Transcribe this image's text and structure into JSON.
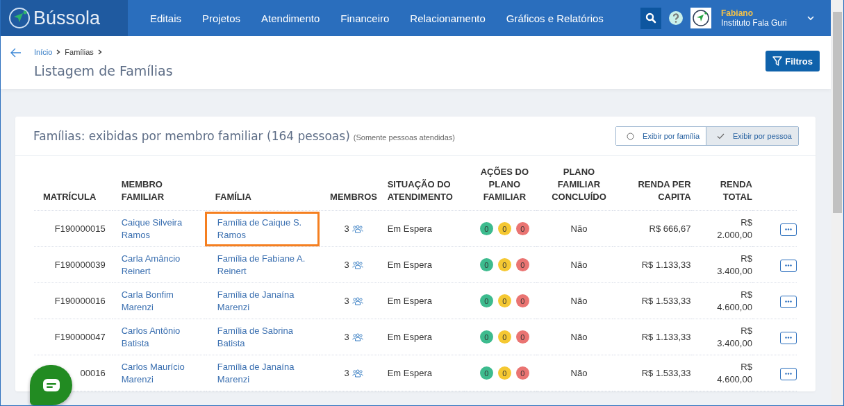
{
  "brand": {
    "name": "Bússola"
  },
  "nav": [
    "Editais",
    "Projetos",
    "Atendimento",
    "Financeiro",
    "Relacionamento",
    "Gráficos e Relatórios"
  ],
  "user": {
    "name": "Fabiano",
    "org": "Instituto Fala Guri"
  },
  "breadcrumb": [
    {
      "label": "Início",
      "link": true
    },
    {
      "label": "Famílias",
      "link": false
    }
  ],
  "page_title": "Listagem de Famílias",
  "filters_button": "Filtros",
  "card": {
    "title": "Famílias: exibidas por membro familiar (164 pessoas)",
    "note": "(Somente pessoas atendidas)",
    "view_options": [
      {
        "label": "Exibir por família",
        "selected": false
      },
      {
        "label": "Exibir por pessoa",
        "selected": true
      }
    ]
  },
  "table": {
    "columns": [
      "MATRÍCULA",
      "MEMBRO FAMILIAR",
      "FAMÍLIA",
      "MEMBROS",
      "SITUAÇÃO DO ATENDIMENTO",
      "AÇÕES DO PLANO FAMILIAR",
      "PLANO FAMILIAR CONCLUÍDO",
      "RENDA PER CAPITA",
      "RENDA TOTAL"
    ],
    "rows": [
      {
        "matricula": "F190000015",
        "membro": "Caique Silveira Ramos",
        "familia": "Família de Caique S. Ramos",
        "highlighted": true,
        "membros": "3",
        "situacao": "Em Espera",
        "acoes": [
          {
            "count": "0",
            "color": "#3dbb8e"
          },
          {
            "count": "0",
            "color": "#f5c832"
          },
          {
            "count": "0",
            "color": "#ea7472"
          }
        ],
        "concluido": "Não",
        "renda_per_capita": "R$ 666,67",
        "renda_total": "R$ 2.000,00"
      },
      {
        "matricula": "F190000039",
        "membro": "Carla Amâncio Reinert",
        "familia": "Família de Fabiane A. Reinert",
        "highlighted": false,
        "membros": "3",
        "situacao": "Em Espera",
        "acoes": [
          {
            "count": "0",
            "color": "#3dbb8e"
          },
          {
            "count": "0",
            "color": "#f5c832"
          },
          {
            "count": "0",
            "color": "#ea7472"
          }
        ],
        "concluido": "Não",
        "renda_per_capita": "R$ 1.133,33",
        "renda_total": "R$ 3.400,00"
      },
      {
        "matricula": "F190000016",
        "membro": "Carla Bonfim Marenzi",
        "familia": "Família de Janaína Marenzi",
        "highlighted": false,
        "membros": "3",
        "situacao": "Em Espera",
        "acoes": [
          {
            "count": "0",
            "color": "#3dbb8e"
          },
          {
            "count": "0",
            "color": "#f5c832"
          },
          {
            "count": "0",
            "color": "#ea7472"
          }
        ],
        "concluido": "Não",
        "renda_per_capita": "R$ 1.533,33",
        "renda_total": "R$ 4.600,00"
      },
      {
        "matricula": "F190000047",
        "membro": "Carlos Antônio Batista",
        "familia": "Família de Sabrina Batista",
        "highlighted": false,
        "membros": "3",
        "situacao": "Em Espera",
        "acoes": [
          {
            "count": "0",
            "color": "#3dbb8e"
          },
          {
            "count": "0",
            "color": "#f5c832"
          },
          {
            "count": "0",
            "color": "#ea7472"
          }
        ],
        "concluido": "Não",
        "renda_per_capita": "R$ 1.133,33",
        "renda_total": "R$ 3.400,00"
      },
      {
        "matricula": "00016",
        "membro": "Carlos Maurício Marenzi",
        "familia": "Família de Janaína Marenzi",
        "highlighted": false,
        "membros": "3",
        "situacao": "Em Espera",
        "acoes": [
          {
            "count": "0",
            "color": "#3dbb8e"
          },
          {
            "count": "0",
            "color": "#f5c832"
          },
          {
            "count": "0",
            "color": "#ea7472"
          }
        ],
        "concluido": "Não",
        "renda_per_capita": "R$ 1.533,33",
        "renda_total": "R$ 4.600,00"
      }
    ]
  }
}
